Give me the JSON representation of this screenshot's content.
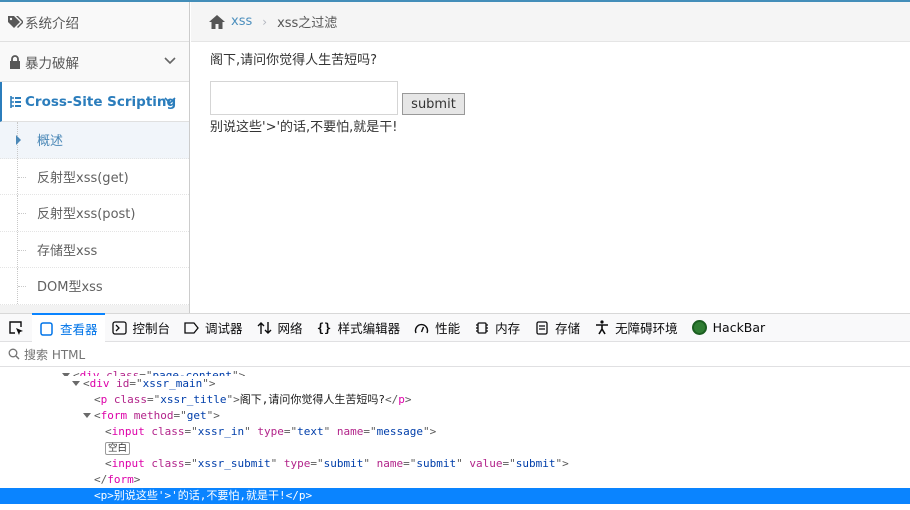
{
  "sidebar": {
    "items": [
      {
        "label": "系统介绍",
        "icon": "tags-icon"
      },
      {
        "label": "暴力破解",
        "icon": "lock-icon"
      },
      {
        "label": "Cross-Site Scripting",
        "icon": "list-tree-icon"
      }
    ],
    "subitems": [
      {
        "label": "概述",
        "active": true
      },
      {
        "label": "反射型xss(get)"
      },
      {
        "label": "反射型xss(post)"
      },
      {
        "label": "存储型xss"
      },
      {
        "label": "DOM型xss"
      }
    ]
  },
  "breadcrumb": {
    "root": "xss",
    "current": "xss之过滤"
  },
  "main": {
    "title": "阁下,请问你觉得人生苦短吗?",
    "input_value": "",
    "submit_label": "submit",
    "message": "别说这些'>'的话,不要怕,就是干!"
  },
  "devtools": {
    "tabs": [
      {
        "label": "查看器",
        "icon": "inspector-icon",
        "selected": true
      },
      {
        "label": "控制台",
        "icon": "console-icon"
      },
      {
        "label": "调试器",
        "icon": "debugger-icon"
      },
      {
        "label": "网络",
        "icon": "network-icon"
      },
      {
        "label": "样式编辑器",
        "icon": "style-editor-icon"
      },
      {
        "label": "性能",
        "icon": "performance-icon"
      },
      {
        "label": "内存",
        "icon": "memory-icon"
      },
      {
        "label": "存储",
        "icon": "storage-icon"
      },
      {
        "label": "无障碍环境",
        "icon": "accessibility-icon"
      },
      {
        "label": "HackBar",
        "icon": "hackbar-icon"
      }
    ],
    "search_placeholder": "搜索 HTML",
    "tree": {
      "l0": {
        "tag": "div",
        "attr": "class",
        "value": "page-content"
      },
      "l1": {
        "tag": "div",
        "attr": "id",
        "value": "xssr_main"
      },
      "l2": {
        "tag": "p",
        "attr": "class",
        "value": "xssr_title",
        "text": "阁下,请问你觉得人生苦短吗?"
      },
      "l3": {
        "tag": "form",
        "attr": "method",
        "value": "get"
      },
      "l4": {
        "tag": "input",
        "a1": "class",
        "v1": "xssr_in",
        "a2": "type",
        "v2": "text",
        "a3": "name",
        "v3": "message"
      },
      "whitespace": "空白",
      "l5": {
        "tag": "input",
        "a1": "class",
        "v1": "xssr_submit",
        "a2": "type",
        "v2": "submit",
        "a3": "name",
        "v3": "submit",
        "a4": "value",
        "v4": "submit"
      },
      "l6": {
        "close": "form"
      },
      "l7": {
        "tag": "p",
        "text": "别说这些'>'的话,不要怕,就是干!"
      }
    }
  },
  "colors": {
    "accent": "#438eb9",
    "active_nav": "#2b7dbc",
    "devtools_selected": "#0a84ff",
    "hackbar": "#2f7d32"
  }
}
